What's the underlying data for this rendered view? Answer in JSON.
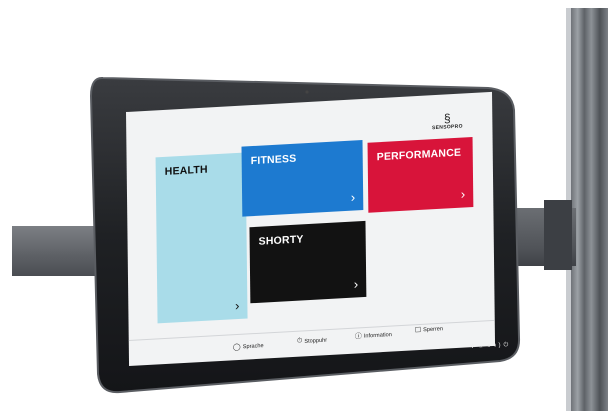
{
  "brand": {
    "name": "SENSOPRO",
    "mark": "§"
  },
  "tiles": {
    "health": {
      "label": "HEALTH",
      "chevron": "›"
    },
    "fitness": {
      "label": "FITNESS",
      "chevron": "›"
    },
    "performance": {
      "label": "PERFORMANCE",
      "chevron": "›"
    },
    "shorty": {
      "label": "SHORTY",
      "chevron": "›"
    }
  },
  "toolbar": {
    "sprache": {
      "label": "Sprache",
      "icon": "speech-bubble-icon"
    },
    "stoppuhr": {
      "label": "Stoppuhr",
      "icon": "stopwatch-icon"
    },
    "information": {
      "label": "Information",
      "icon": "info-icon"
    },
    "sperren": {
      "label": "Sperren",
      "icon": "lock-icon"
    }
  },
  "colors": {
    "health": "#a9dce9",
    "fitness": "#1d7ad0",
    "performance": "#d8143a",
    "shorty": "#121212"
  }
}
